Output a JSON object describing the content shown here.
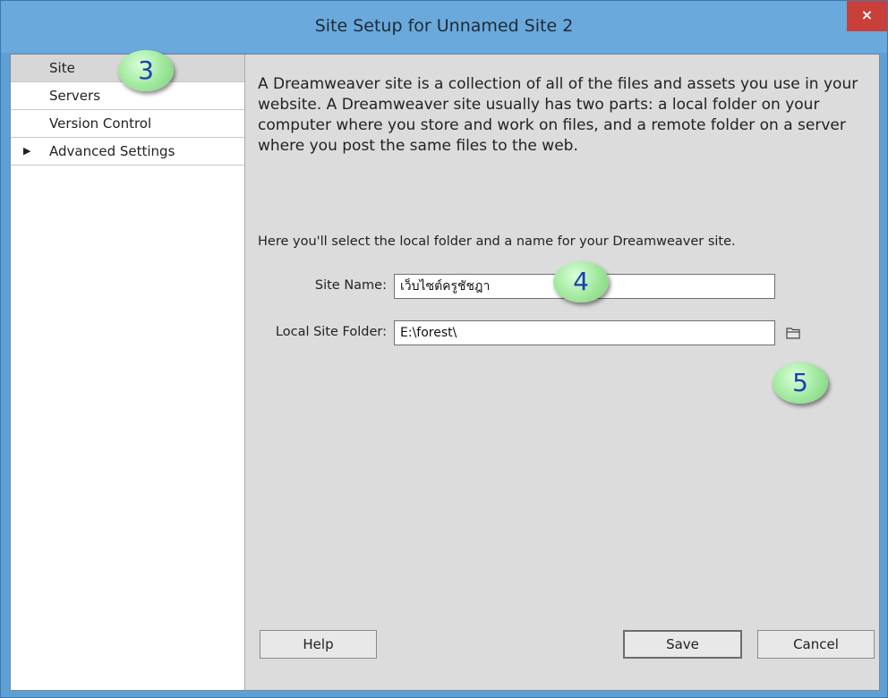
{
  "window": {
    "title": "Site Setup for Unnamed Site 2",
    "close_glyph": "×"
  },
  "sidebar": {
    "items": [
      {
        "label": "Site",
        "selected": true
      },
      {
        "label": "Servers"
      },
      {
        "label": "Version Control"
      },
      {
        "label": "Advanced Settings",
        "expandable": true
      }
    ],
    "arrow_glyph": "▶"
  },
  "main": {
    "description": "A Dreamweaver site is a collection of all of the files and assets you use in your website. A Dreamweaver site usually has two parts: a local folder on your computer where you store and work on files, and a remote folder on a server where you post the same files to the web.",
    "instruction": "Here you'll select the local folder and a name for your Dreamweaver site.",
    "site_name_label": "Site Name:",
    "site_name_value": "เว็บไซต์ครูชัชฎา",
    "local_folder_label": "Local Site Folder:",
    "local_folder_value": "E:\\forest\\"
  },
  "buttons": {
    "help": "Help",
    "save": "Save",
    "cancel": "Cancel"
  },
  "markers": {
    "step3": "3",
    "step4": "4",
    "step5": "5"
  },
  "colors": {
    "titlebar": "#6aa9dc",
    "close": "#c9403b",
    "marker_fill": "#9ee79b",
    "marker_text": "#1d3fb0"
  },
  "icons": {
    "folder": "folder-icon"
  }
}
